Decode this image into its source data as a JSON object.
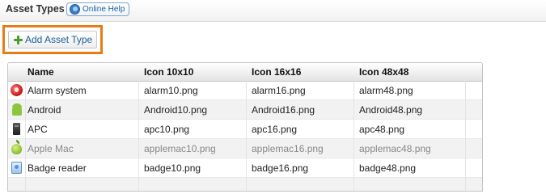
{
  "header": {
    "title": "Asset Types",
    "help_label": "Online Help"
  },
  "toolbar": {
    "add_label": "Add Asset Type",
    "highlight_color": "#e87b14"
  },
  "table": {
    "columns": [
      "Name",
      "Icon 10x10",
      "Icon 16x16",
      "Icon 48x48"
    ],
    "rows": [
      {
        "icon": "alarm-icon",
        "name": "Alarm system",
        "icon10": "alarm10.png",
        "icon16": "alarm16.png",
        "icon48": "alarm48.png"
      },
      {
        "icon": "android-icon",
        "name": "Android",
        "icon10": "Android10.png",
        "icon16": "Android16.png",
        "icon48": "Android48.png"
      },
      {
        "icon": "apc-icon",
        "name": "APC",
        "icon10": "apc10.png",
        "icon16": "apc16.png",
        "icon48": "apc48.png"
      },
      {
        "icon": "apple-icon",
        "name": "Apple Mac",
        "icon10": "applemac10.png",
        "icon16": "applemac16.png",
        "icon48": "applemac48.png",
        "dimmed": true
      },
      {
        "icon": "badge-reader-icon",
        "name": "Badge reader",
        "icon10": "badge10.png",
        "icon16": "badge16.png",
        "icon48": "badge48.png"
      }
    ]
  }
}
